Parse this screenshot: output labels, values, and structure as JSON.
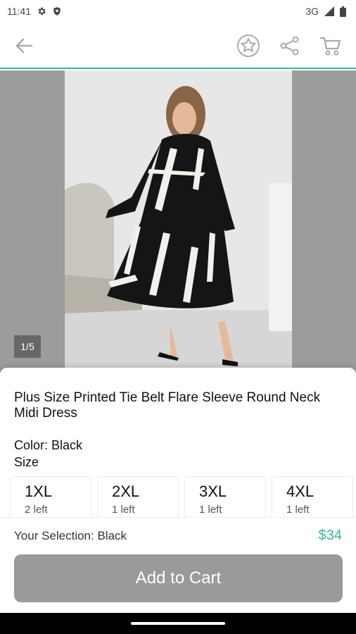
{
  "status_bar": {
    "time": "11:41",
    "network": "3G"
  },
  "app_bar": {
    "icons": [
      "back-arrow-icon",
      "star-icon",
      "share-icon",
      "cart-icon"
    ],
    "accent_color": "#35b991"
  },
  "gallery": {
    "image_counter": "1/5"
  },
  "product": {
    "title": "Plus Size Printed Tie Belt Flare Sleeve Round Neck Midi Dress",
    "color_label": "Color: Black",
    "size_label": "Size",
    "sizes": [
      {
        "name": "1XL",
        "stock": "2 left"
      },
      {
        "name": "2XL",
        "stock": "1 left"
      },
      {
        "name": "3XL",
        "stock": "1 left"
      },
      {
        "name": "4XL",
        "stock": "1 left"
      }
    ]
  },
  "footer": {
    "selection": "Your Selection: Black",
    "price": "$34",
    "add_to_cart": "Add to Cart"
  }
}
